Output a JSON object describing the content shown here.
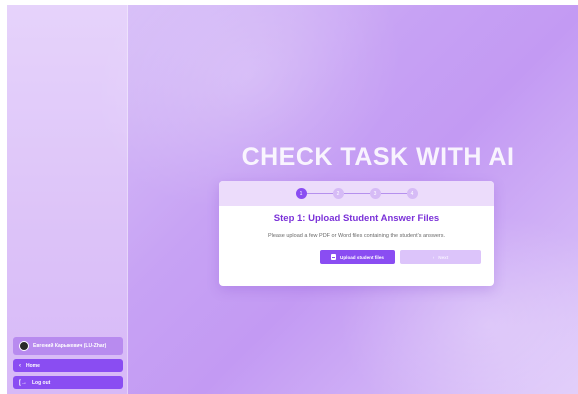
{
  "sidebar": {
    "user_name": "Евгений Карыкевич (LU-Zhar)",
    "home_label": "Home",
    "home_icon": "chevron-left-icon",
    "logout_label": "Log out",
    "logout_icon": "logout-icon"
  },
  "main": {
    "title": "CHECK TASK WITH AI",
    "steps": [
      "1",
      "2",
      "3",
      "4"
    ],
    "active_step": 1,
    "step_title": "Step 1: Upload Student Answer Files",
    "step_description": "Please upload a few PDF or Word files containing the student's answers.",
    "upload_label": "Upload student files",
    "upload_icon": "file-icon",
    "next_label": "Next",
    "next_icon": "chevron-right-icon"
  },
  "colors": {
    "accent": "#8a4df2",
    "accent_light": "#dcc4fa",
    "title_purple": "#7b32d8"
  }
}
